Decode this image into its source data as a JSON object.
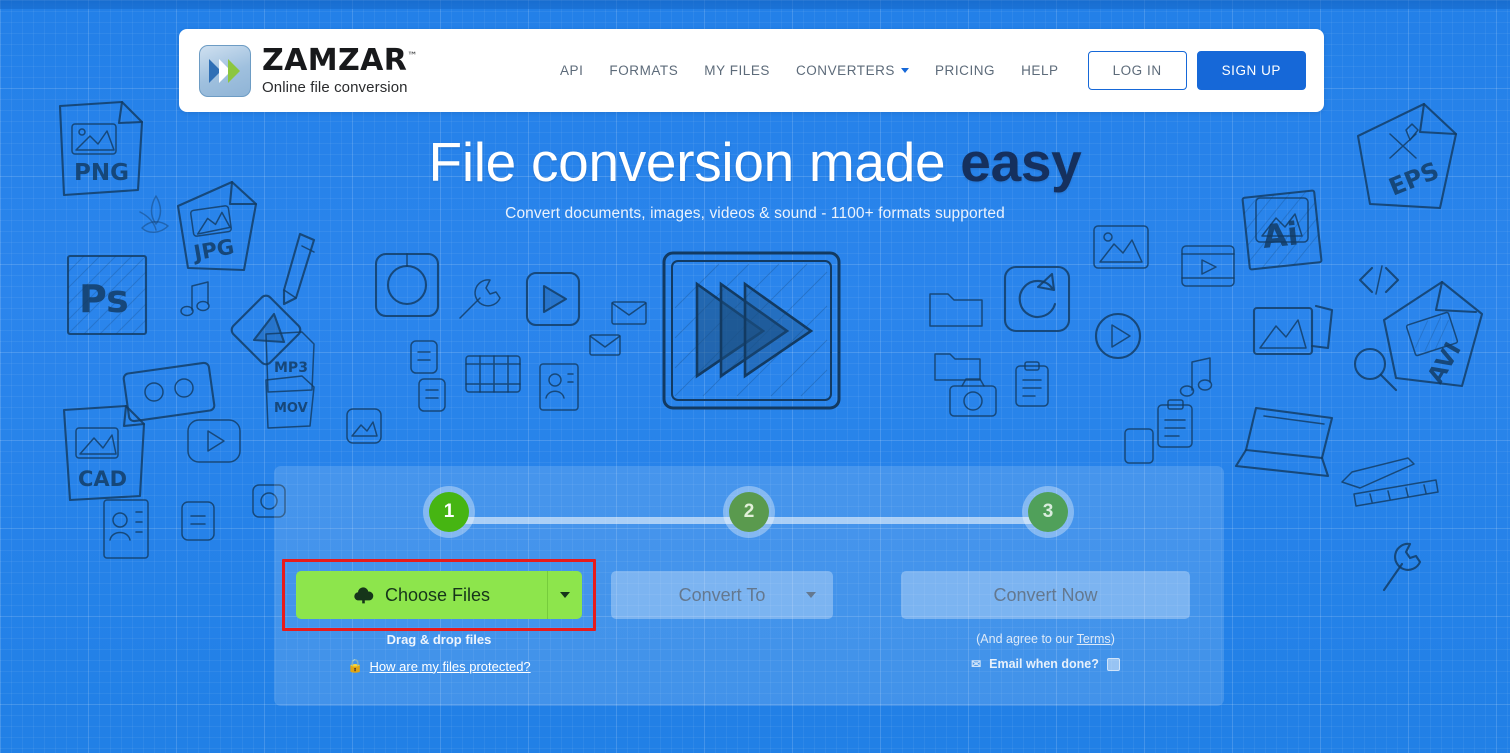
{
  "brand": {
    "name": "ZAMZAR",
    "tm": "™",
    "tagline": "Online file conversion",
    "logo_icon": "double-chevron-logo",
    "accent_blue": "#1668d8",
    "accent_green": "#8de54c",
    "bg_blue": "#2380e8",
    "highlight_red": "#e81b1b"
  },
  "nav": {
    "items": [
      {
        "label": "API",
        "has_caret": false
      },
      {
        "label": "FORMATS",
        "has_caret": false
      },
      {
        "label": "MY FILES",
        "has_caret": false
      },
      {
        "label": "CONVERTERS",
        "has_caret": true
      },
      {
        "label": "PRICING",
        "has_caret": false
      },
      {
        "label": "HELP",
        "has_caret": false
      }
    ],
    "login_label": "LOG IN",
    "signup_label": "SIGN UP"
  },
  "hero": {
    "title_plain": "File conversion made ",
    "title_bold": "easy",
    "subtitle": "Convert documents, images, videos & sound - 1100+ formats supported",
    "art_icon": "fast-forward-video-sketch"
  },
  "panel": {
    "steps": [
      {
        "number": "1",
        "state": "active"
      },
      {
        "number": "2",
        "state": "inactive"
      },
      {
        "number": "3",
        "state": "inactive"
      }
    ],
    "choose_files": {
      "label": "Choose Files",
      "icon": "cloud-upload-icon",
      "caret_icon": "chevron-down-icon",
      "highlighted": true,
      "drag_drop_text": "Drag & drop files",
      "protected_link": "How are my files protected?",
      "protected_icon": "lock-icon"
    },
    "convert_to": {
      "label": "Convert To",
      "caret_icon": "chevron-down-icon",
      "disabled": true
    },
    "convert_now": {
      "label": "Convert Now",
      "disabled": true,
      "terms_prefix": "(And agree to our ",
      "terms_link": "Terms",
      "terms_suffix": ")",
      "email_icon": "envelope-icon",
      "email_label": "Email when done?",
      "email_checked": false
    }
  },
  "background": {
    "style": "blueprint-grid",
    "doodle_labels": [
      "PNG",
      "JPG",
      "Ps",
      "CAD",
      "MP3",
      "MOV",
      "EPS",
      "Ai",
      "AVI"
    ]
  }
}
